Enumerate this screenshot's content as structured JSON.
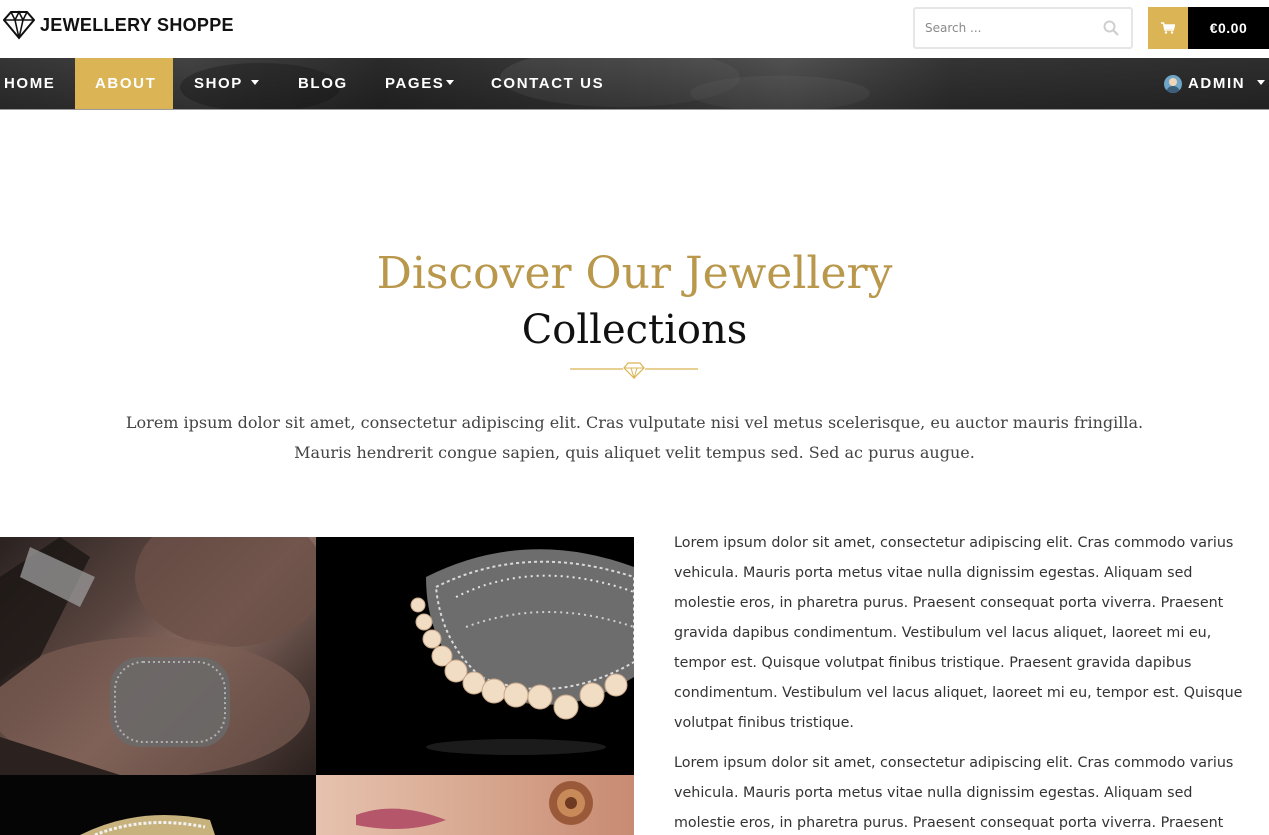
{
  "header": {
    "logo_text": "JEWELLERY SHOPPE",
    "search_placeholder": "Search ...",
    "cart_total": "€0.00"
  },
  "nav": {
    "items": [
      {
        "label": "HOME",
        "active": false
      },
      {
        "label": "ABOUT",
        "active": true
      },
      {
        "label": "SHOP",
        "active": false,
        "dropdown": true
      },
      {
        "label": "BLOG",
        "active": false
      },
      {
        "label": "PAGES",
        "active": false,
        "dropdown": true
      },
      {
        "label": "CONTACT US",
        "active": false
      }
    ],
    "user_label": "ADMIN"
  },
  "hero": {
    "title_line1": "Discover Our Jewellery",
    "title_line2": "Collections",
    "text": "Lorem ipsum dolor sit amet, consectetur adipiscing elit. Cras vulputate nisi vel metus scelerisque, eu auctor mauris fringilla. Mauris hendrerit congue sapien, quis aliquet velit tempus sed. Sed ac purus augue."
  },
  "about": {
    "paragraph1": "Lorem ipsum dolor sit amet, consectetur adipiscing elit. Cras commodo varius vehicula. Mauris porta metus vitae nulla dignissim egestas. Aliquam sed molestie eros, in pharetra purus. Praesent consequat porta viverra. Praesent gravida dapibus condimentum. Vestibulum vel lacus aliquet, laoreet mi eu, tempor est. Quisque volutpat finibus tristique. Praesent gravida dapibus condimentum. Vestibulum vel lacus aliquet, laoreet mi eu, tempor est. Quisque volutpat finibus tristique.",
    "paragraph2": "Lorem ipsum dolor sit amet, consectetur adipiscing elit. Cras commodo varius vehicula. Mauris porta metus vitae nulla dignissim egestas. Aliquam sed molestie eros, in pharetra purus. Praesent consequat porta viverra. Praesent gravida"
  },
  "colors": {
    "accent_gold": "#dbb456",
    "title_gold": "#b9974b",
    "nav_dark": "#3a3a3a",
    "cart_black": "#000000"
  },
  "icons": [
    "diamond-logo-icon",
    "search-icon",
    "cart-icon",
    "chevron-down-icon",
    "avatar",
    "diamond-divider-icon"
  ]
}
